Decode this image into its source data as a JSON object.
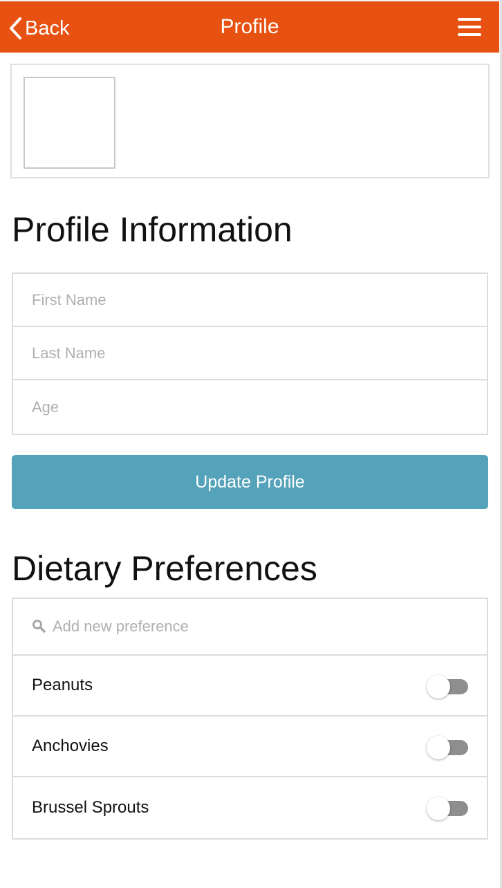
{
  "header": {
    "back_label": "Back",
    "title": "Profile",
    "color": "#e75212"
  },
  "profile_section": {
    "title": "Profile Information",
    "fields": [
      {
        "placeholder": "First Name",
        "value": ""
      },
      {
        "placeholder": "Last Name",
        "value": ""
      },
      {
        "placeholder": "Age",
        "value": ""
      }
    ],
    "update_button_label": "Update Profile",
    "update_button_color": "#55a2bb"
  },
  "dietary_section": {
    "title": "Dietary Preferences",
    "search_placeholder": "Add new preference",
    "items": [
      {
        "label": "Peanuts",
        "enabled": false
      },
      {
        "label": "Anchovies",
        "enabled": false
      },
      {
        "label": "Brussel Sprouts",
        "enabled": false
      }
    ]
  },
  "icons": {
    "back": "chevron-left-icon",
    "menu": "hamburger-menu-icon",
    "search": "search-icon"
  }
}
